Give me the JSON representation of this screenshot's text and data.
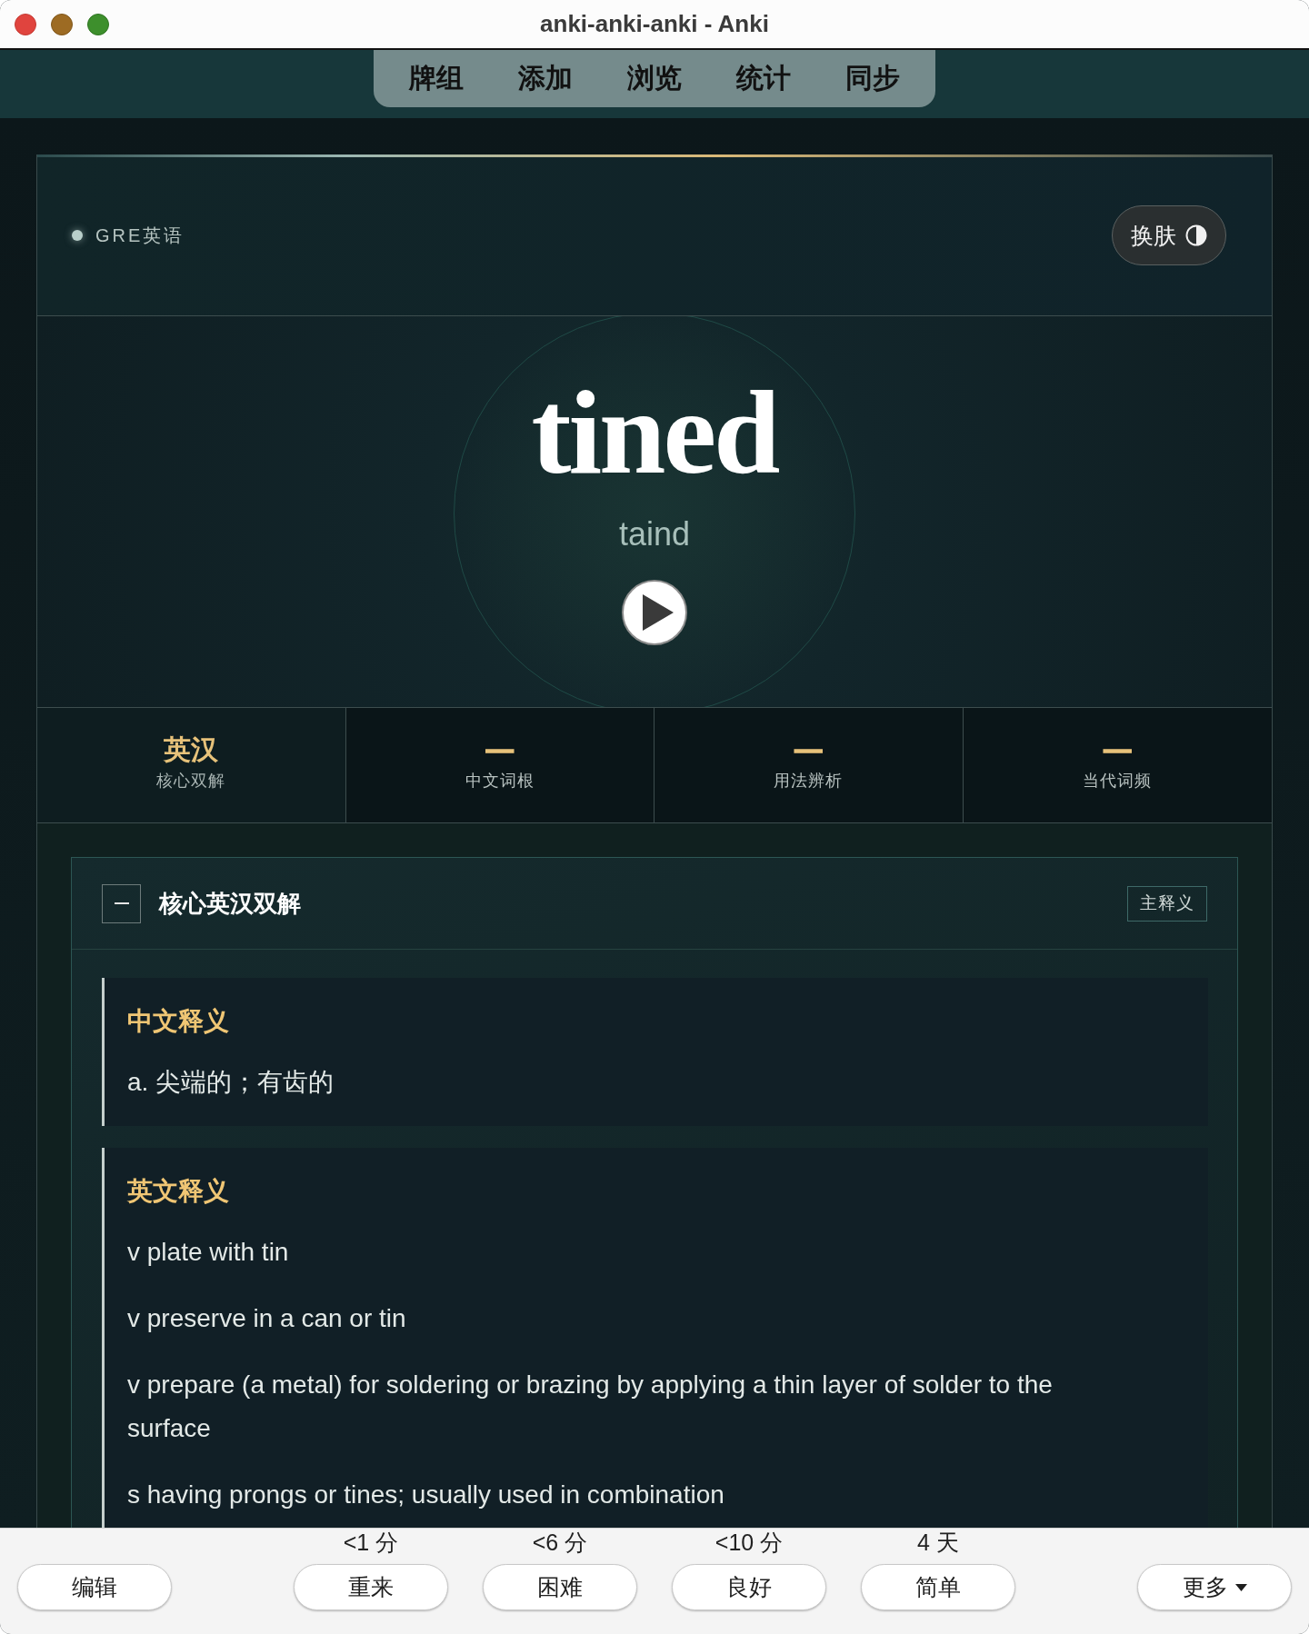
{
  "window": {
    "title": "anki-anki-anki - Anki"
  },
  "nav": [
    "牌组",
    "添加",
    "浏览",
    "统计",
    "同步"
  ],
  "card": {
    "deck": "GRE英语",
    "skin_button": "换肤",
    "word": "tined",
    "phonetic": "taind"
  },
  "tabs": [
    {
      "title": "英汉",
      "subtitle": "核心双解",
      "selected": true
    },
    {
      "title": "—",
      "subtitle": "中文词根",
      "selected": false
    },
    {
      "title": "—",
      "subtitle": "用法辨析",
      "selected": false
    },
    {
      "title": "—",
      "subtitle": "当代词频",
      "selected": false
    }
  ],
  "section": {
    "title": "核心英汉双解",
    "badge": "主释义",
    "expanded": true,
    "blocks": [
      {
        "heading": "中文释义",
        "lines": [
          "a. 尖端的；有齿的"
        ]
      },
      {
        "heading": "英文释义",
        "lines": [
          "v plate with tin",
          "v preserve in a can or tin",
          "v prepare (a metal) for soldering or brazing by applying a thin layer of solder to the surface",
          "s having prongs or tines; usually used in combination"
        ]
      }
    ]
  },
  "bottom_bar": {
    "edit": "编辑",
    "answers": [
      {
        "interval": "<1 分",
        "label": "重来"
      },
      {
        "interval": "<6 分",
        "label": "困难"
      },
      {
        "interval": "<10 分",
        "label": "良好"
      },
      {
        "interval": "4 天",
        "label": "简单"
      }
    ],
    "more": "更多"
  }
}
